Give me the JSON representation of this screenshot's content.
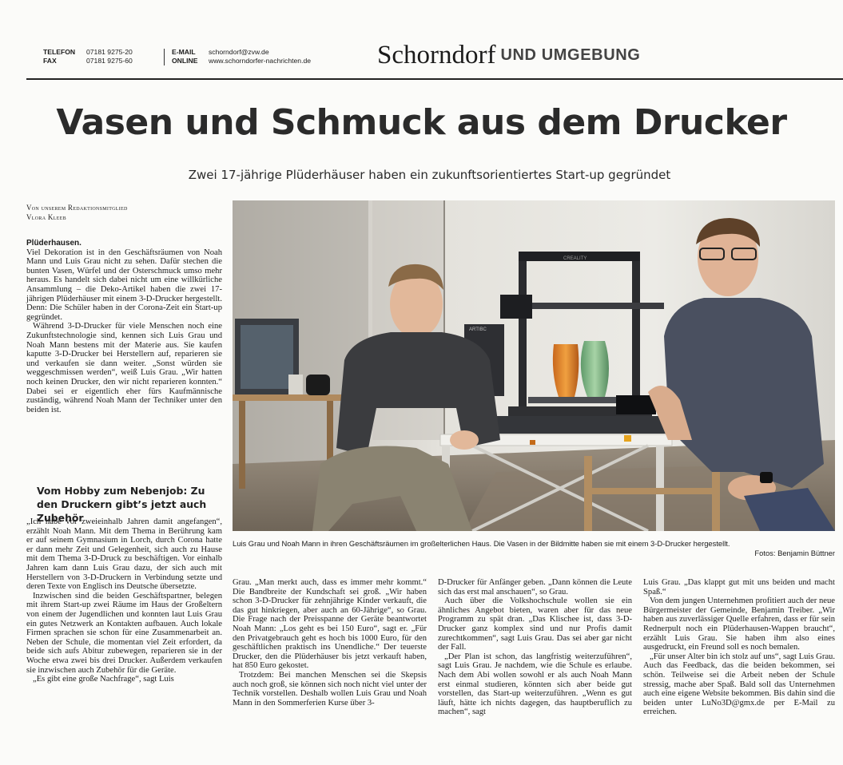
{
  "header": {
    "phone_label": "TELEFON",
    "phone_value": "07181 9275-20",
    "fax_label": "FAX",
    "fax_value": "07181 9275-60",
    "email_label": "E-MAIL",
    "email_value": "schorndorf@zvw.de",
    "online_label": "ONLINE",
    "online_value": "www.schorndorfer-nachrichten.de",
    "section_title": "Schorndorf",
    "section_sub": "UND UMGEBUNG"
  },
  "article": {
    "headline": "Vasen und Schmuck aus dem Drucker",
    "subheadline": "Zwei 17-jährige Plüderhäuser haben ein zukunftsorientiertes Start-up gegründet",
    "byline_1": "Von unserem Redaktionsmitglied",
    "byline_2": "Vlora Kleeb",
    "dateline": "Plüderhausen.",
    "p1": "Viel Dekoration ist in den Geschäftsräumen von Noah Mann und Luis Grau nicht zu sehen. Dafür stechen die bunten Vasen, Würfel und der Osterschmuck umso mehr heraus. Es handelt sich dabei nicht um eine willkürliche Ansammlung – die Deko-Artikel haben die zwei 17-jährigen Plüderhäuser mit einem 3-D-Drucker hergestellt. Denn: Die Schüler haben in der Corona-Zeit ein Start-up gegründet.",
    "p2": "Während 3-D-Drucker für viele Menschen noch eine Zukunftstechnologie sind, kennen sich Luis Grau und Noah Mann bestens mit der Materie aus. Sie kaufen kaputte 3-D-Drucker bei Herstellern auf, reparieren sie und verkaufen sie dann weiter. „Sonst würden sie weggeschmissen werden“, weiß Luis Grau. „Wir hatten noch keinen Drucker, den wir nicht reparieren konnten.“ Dabei sei er eigentlich eher fürs Kaufmännische zuständig, während Noah Mann der Techniker unter den beiden ist.",
    "section_head": "Vom Hobby zum Nebenjob: Zu den Druckern gibt’s jetzt auch Zubehör",
    "p3": "„Ich habe vor zweieinhalb Jahren damit angefangen“, erzählt Noah Mann. Mit dem Thema in Berührung kam er auf seinem Gymnasium in Lorch, durch Corona hatte er dann mehr Zeit und Gelegenheit, sich auch zu Hause mit dem Thema 3-D-Druck zu beschäftigen. Vor einhalb Jahren kam dann Luis Grau dazu, der sich auch mit Herstellern von 3-D-Druckern in Verbindung setzte und deren Texte von Englisch ins Deutsche übersetzte.",
    "p4": "Inzwischen sind die beiden Geschäftspartner, belegen mit ihrem Start-up zwei Räume im Haus der Großeltern von einem der Jugendlichen und konnten laut Luis Grau ein gutes Netzwerk an Kontakten aufbauen. Auch lokale Firmen sprachen sie schon für eine Zusammenarbeit an. Neben der Schule, die momentan viel Zeit erfordert, da beide sich aufs Abitur zubewegen, reparieren sie in der Woche etwa zwei bis drei Drucker. Außerdem verkaufen sie inzwischen auch Zubehör für die Geräte.",
    "p5": "„Es gibt eine große Nachfrage“, sagt Luis",
    "p6": "Grau. „Man merkt auch, dass es immer mehr kommt.“ Die Bandbreite der Kundschaft sei groß. „Wir haben schon 3-D-Drucker für zehnjährige Kinder verkauft, die das gut hinkriegen, aber auch an 60-Jährige“, so Grau. Die Frage nach der Preisspanne der Geräte beantwortet Noah Mann: „Los geht es bei 150 Euro“, sagt er. „Für den Privatgebrauch geht es hoch bis 1000 Euro, für den geschäftlichen praktisch ins Unendliche.“ Der teuerste Drucker, den die Plüderhäuser bis jetzt verkauft haben, hat 850 Euro gekostet.",
    "p7": "Trotzdem: Bei manchen Menschen sei die Skepsis auch noch groß, sie können sich noch nicht viel unter der Technik vorstellen. Deshalb wollen Luis Grau und Noah Mann in den Sommerferien Kurse über 3-",
    "p8": "D-Drucker für Anfänger geben. „Dann können die Leute sich das erst mal anschauen“, so Grau.",
    "p9": "Auch über die Volkshochschule wollen sie ein ähnliches Angebot bieten, waren aber für das neue Programm zu spät dran. „Das Klischee ist, dass 3-D-Drucker ganz komplex sind und nur Profis damit zurechtkommen“, sagt Luis Grau. Das sei aber gar nicht der Fall.",
    "p10": "„Der Plan ist schon, das langfristig weiterzuführen“, sagt Luis Grau. Je nachdem, wie die Schule es erlaube. Nach dem Abi wollen sowohl er als auch Noah Mann erst einmal studieren, könnten sich aber beide gut vorstellen, das Start-up weiterzuführen. „Wenn es gut läuft, hätte ich nichts dagegen, das hauptberuflich zu machen“, sagt",
    "p11": "Luis Grau. „Das klappt gut mit uns beiden und macht Spaß.“",
    "p12": "Von dem jungen Unternehmen profitiert auch der neue Bürgermeister der Gemeinde, Benjamin Treiber. „Wir haben aus zuverlässiger Quelle erfahren, dass er für sein Rednerpult noch ein Plüderhausen-Wappen braucht“, erzählt Luis Grau. Sie haben ihm also eines ausgedruckt, ein Freund soll es noch bemalen.",
    "p13": "„Für unser Alter bin ich stolz auf uns“, sagt Luis Grau. Auch das Feedback, das die beiden bekommen, sei schön. Teilweise sei die Arbeit neben der Schule stressig, mache aber Spaß. Bald soll das Unternehmen auch eine eigene Website bekommen. Bis dahin sind die beiden unter LuNo3D@gmx.de per E-Mail zu erreichen.",
    "caption": "Luis Grau und Noah Mann in ihren Geschäftsräumen im großelterlichen Haus. Die Vasen in der Bildmitte haben sie mit einem 3-D-Drucker hergestellt.",
    "credit": "Fotos: Benjamin Büttner",
    "printer_brand": "CREALITY",
    "printer_small_brand": "ARTIBC"
  }
}
